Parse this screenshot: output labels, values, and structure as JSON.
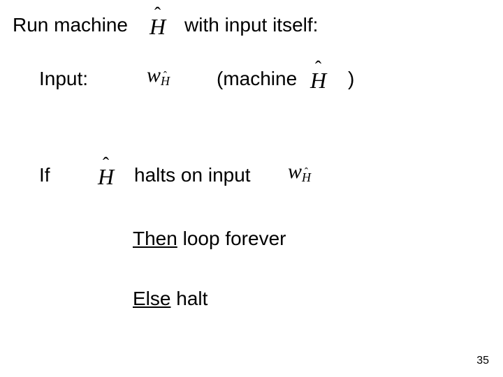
{
  "line1": {
    "run_machine": "Run machine",
    "with_input_itself": "with input itself:"
  },
  "line2": {
    "input_label": "Input:",
    "machine_open": "(machine",
    "machine_close": ")"
  },
  "line3": {
    "if": "If",
    "halts_on_input": "halts on input"
  },
  "line4": {
    "then": "Then",
    "loop_forever": " loop forever"
  },
  "line5": {
    "else": "Else",
    "halt": " halt"
  },
  "symbols": {
    "Hhat": "H",
    "hat": "ˆ",
    "w": "w"
  },
  "page_number": "35"
}
